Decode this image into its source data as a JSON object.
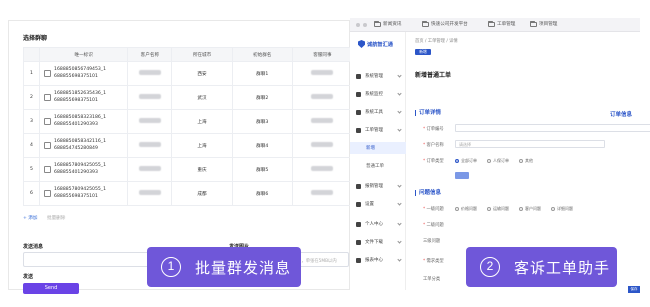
{
  "group_panel": {
    "title": "选择群聊",
    "columns": [
      "",
      "唯一标识",
      "客户名称",
      "所在城市",
      "初始群名",
      "客服同事"
    ],
    "rows": [
      {
        "num": "1",
        "id_line1": "1688850856749453_1",
        "id_line2": "688855698375101",
        "city": "西安",
        "group": "群聊1"
      },
      {
        "num": "2",
        "id_line1": "1688851852635436_1",
        "id_line2": "688855698375101",
        "city": "武汉",
        "group": "群聊2"
      },
      {
        "num": "3",
        "id_line1": "1688850858323186_1",
        "id_line2": "688855401290393",
        "city": "上海",
        "group": "群聊3"
      },
      {
        "num": "4",
        "id_line1": "1688850858342116_1",
        "id_line2": "688854745280849",
        "city": "上海",
        "group": "群聊4"
      },
      {
        "num": "5",
        "id_line1": "1688857809425055_1",
        "id_line2": "688855401290393",
        "city": "重庆",
        "group": "群聊5"
      },
      {
        "num": "6",
        "id_line1": "1688857809425055_1",
        "id_line2": "688855698375101",
        "city": "成都",
        "group": "群聊6"
      }
    ],
    "add_label": "+ 添加",
    "batch_delete_label": "批量删除",
    "message_label": "发送消息",
    "image_label": "发送图片",
    "image_choose": "选择",
    "image_placeholder": "直接将文件拖拽或粘贴到此处，单张在5MB以内",
    "send_section_label": "发送",
    "send_button": "Send"
  },
  "ticket_panel": {
    "top_tabs": [
      "新闻资讯",
      "快速公司开发平台",
      "工单管理",
      "项目管理"
    ],
    "logo": "诚航智汇通",
    "breadcrumb": "首页 / 工单管理 / 详情",
    "chip": "新增",
    "page_title": "新增普通工单",
    "nav": [
      {
        "label": "系统管理",
        "icon": "settings-icon"
      },
      {
        "label": "系统监控",
        "icon": "monitor-icon"
      },
      {
        "label": "系统工具",
        "icon": "tools-icon"
      },
      {
        "label": "工单管理",
        "icon": "ticket-icon"
      },
      {
        "label": "新增",
        "sub": true,
        "active": true
      },
      {
        "label": "普通工单",
        "sub": true
      },
      {
        "label": "报销管理",
        "icon": "receipt-icon"
      },
      {
        "label": "设置",
        "icon": "gear-icon"
      },
      {
        "label": "个人中心",
        "icon": "user-icon"
      },
      {
        "label": "文件下载",
        "icon": "download-icon"
      },
      {
        "label": "报表中心",
        "icon": "chart-icon"
      }
    ],
    "section_order": "订单详情",
    "section_order_info": "订单信息",
    "field_order_no": "订单编号",
    "field_customer": "客户名称",
    "field_customer_placeholder": "请选择",
    "field_order_type": "订单类型",
    "order_type_options": [
      "全部订单",
      "人保订单",
      "其他"
    ],
    "section_issue": "问题信息",
    "field_level1": "一级问题",
    "level1_options": [
      "价格问题",
      "运输问题",
      "客户问题",
      "详细问题"
    ],
    "field_level2": "二级问题",
    "field_level3": "三级问题",
    "field_type": "需求类型",
    "field_tag": "工单分类",
    "corner_button": "保存"
  },
  "callouts": [
    {
      "num": "1",
      "text": "批量群发消息"
    },
    {
      "num": "2",
      "text": "客诉工单助手"
    }
  ]
}
